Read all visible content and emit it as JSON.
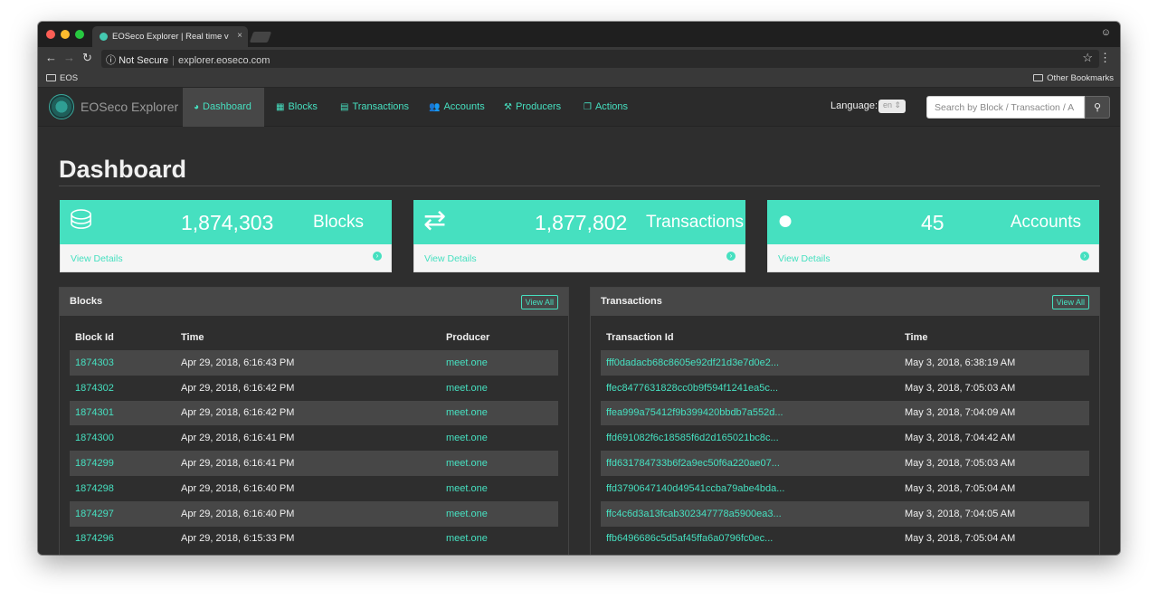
{
  "browser": {
    "tab_title": "EOSeco Explorer | Real time v",
    "tab_close": "×",
    "security": "Not Secure",
    "url": "explorer.eoseco.com",
    "bookmark_left": "EOS",
    "bookmark_right": "Other Bookmarks"
  },
  "navbar": {
    "brand": "EOSeco Explorer",
    "items": [
      {
        "label": "Dashboard",
        "icon": "dashboard-icon",
        "glyph": "◕"
      },
      {
        "label": "Blocks",
        "icon": "grid-icon",
        "glyph": "▦"
      },
      {
        "label": "Transactions",
        "icon": "list-icon",
        "glyph": "▤"
      },
      {
        "label": "Accounts",
        "icon": "users-icon",
        "glyph": "👥"
      },
      {
        "label": "Producers",
        "icon": "gavel-icon",
        "glyph": "⚒"
      },
      {
        "label": "Actions",
        "icon": "copy-icon",
        "glyph": "❐"
      }
    ],
    "language_label": "Language:",
    "language_value": "en",
    "search_placeholder": "Search by Block / Transaction / A"
  },
  "page": {
    "title": "Dashboard"
  },
  "stats": [
    {
      "value": "1,874,303",
      "label": "Blocks",
      "icon": "database-icon",
      "link": "View Details"
    },
    {
      "value": "1,877,802",
      "label": "Transactions",
      "icon": "exchange-icon",
      "link": "View Details"
    },
    {
      "value": "45",
      "label": "Accounts",
      "icon": "user-icon",
      "link": "View Details"
    }
  ],
  "blocks_panel": {
    "title": "Blocks",
    "view_all": "View All",
    "columns": [
      "Block Id",
      "Time",
      "Producer"
    ],
    "rows": [
      [
        "1874303",
        "Apr 29, 2018, 6:16:43 PM",
        "meet.one"
      ],
      [
        "1874302",
        "Apr 29, 2018, 6:16:42 PM",
        "meet.one"
      ],
      [
        "1874301",
        "Apr 29, 2018, 6:16:42 PM",
        "meet.one"
      ],
      [
        "1874300",
        "Apr 29, 2018, 6:16:41 PM",
        "meet.one"
      ],
      [
        "1874299",
        "Apr 29, 2018, 6:16:41 PM",
        "meet.one"
      ],
      [
        "1874298",
        "Apr 29, 2018, 6:16:40 PM",
        "meet.one"
      ],
      [
        "1874297",
        "Apr 29, 2018, 6:16:40 PM",
        "meet.one"
      ],
      [
        "1874296",
        "Apr 29, 2018, 6:15:33 PM",
        "meet.one"
      ]
    ]
  },
  "transactions_panel": {
    "title": "Transactions",
    "view_all": "View All",
    "columns": [
      "Transaction Id",
      "Time"
    ],
    "rows": [
      [
        "fff0dadacb68c8605e92df21d3e7d0e2...",
        "May 3, 2018, 6:38:19 AM"
      ],
      [
        "ffec8477631828cc0b9f594f1241ea5c...",
        "May 3, 2018, 7:05:03 AM"
      ],
      [
        "ffea999a75412f9b399420bbdb7a552d...",
        "May 3, 2018, 7:04:09 AM"
      ],
      [
        "ffd691082f6c18585f6d2d165021bc8c...",
        "May 3, 2018, 7:04:42 AM"
      ],
      [
        "ffd631784733b6f2a9ec50f6a220ae07...",
        "May 3, 2018, 7:05:03 AM"
      ],
      [
        "ffd3790647140d49541ccba79abe4bda...",
        "May 3, 2018, 7:05:04 AM"
      ],
      [
        "ffc4c6d3a13fcab302347778a5900ea3...",
        "May 3, 2018, 7:04:05 AM"
      ],
      [
        "ffb6496686c5d5af45ffa6a0796fc0ec...",
        "May 3, 2018, 7:05:04 AM"
      ]
    ]
  },
  "colors": {
    "accent": "#46e0c0",
    "background": "#2e2e2e",
    "panel_header": "#474747"
  }
}
